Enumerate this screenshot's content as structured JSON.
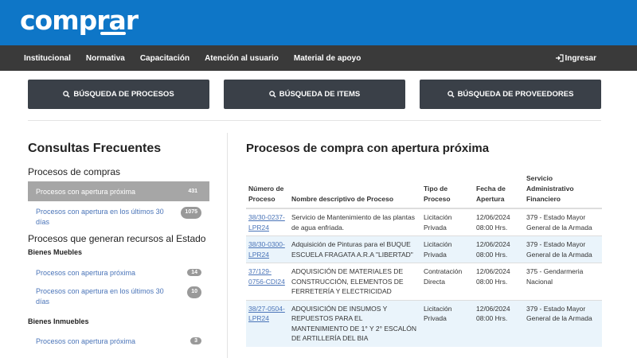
{
  "header": {
    "logo_text": "comprar"
  },
  "nav": {
    "items": [
      "Institucional",
      "Normativa",
      "Capacitación",
      "Atención al usuario",
      "Material de apoyo"
    ],
    "login_label": "Ingresar"
  },
  "search_buttons": [
    {
      "label": "BÚSQUEDA DE PROCESOS"
    },
    {
      "label": "BÚSQUEDA DE ITEMS"
    },
    {
      "label": "BÚSQUEDA DE PROVEEDORES"
    }
  ],
  "sidebar": {
    "title": "Consultas Frecuentes",
    "section1": "Procesos de compras",
    "s1_items": [
      {
        "label": "Procesos con apertura próxima",
        "count": "431"
      },
      {
        "label": "Procesos con apertura en los últimos 30 días",
        "count": "1075"
      }
    ],
    "section2": "Procesos que generan recursos al Estado",
    "sub1": "Bienes Muebles",
    "s2_items": [
      {
        "label": "Procesos con apertura próxima",
        "count": "14"
      },
      {
        "label": "Procesos con apertura en los últimos 30 días",
        "count": "10"
      }
    ],
    "sub2": "Bienes Inmuebles",
    "s3_items": [
      {
        "label": "Procesos con apertura próxima",
        "count": "3"
      }
    ]
  },
  "main": {
    "title": "Procesos de compra con apertura próxima",
    "columns": [
      "Número de Proceso",
      "Nombre descriptivo de Proceso",
      "Tipo de Proceso",
      "Fecha de Apertura",
      "Servicio Administrativo Financiero"
    ],
    "rows": [
      [
        "38/30-0237-LPR24",
        "Servicio de Mantenimiento de las plantas de agua enfriada.",
        "Licitación Privada",
        "12/06/2024 08:00 Hrs.",
        "379 - Estado Mayor General de la Armada"
      ],
      [
        "38/30-0300-LPR24",
        "Adquisición de Pinturas para el BUQUE ESCUELA FRAGATA A.R.A \"LIBERTAD\"",
        "Licitación Privada",
        "12/06/2024 08:00 Hrs.",
        "379 - Estado Mayor General de la Armada"
      ],
      [
        "37/129-0756-CDI24",
        "ADQUISICIÓN DE MATERIALES DE CONSTRUCCIÓN, ELEMENTOS DE FERRETERÍA Y ELECTRICIDAD",
        "Contratación Directa",
        "12/06/2024 08:00 Hrs.",
        "375 - Gendarmeria Nacional"
      ],
      [
        "38/27-0504-LPR24",
        "ADQUISICIÓN DE INSUMOS Y REPUESTOS PARA EL MANTENIMIENTO DE 1° Y 2° ESCALÓN DE ARTILLERÍA DEL BIA",
        "Licitación Privada",
        "12/06/2024 08:00 Hrs.",
        "379 - Estado Mayor General de la Armada"
      ]
    ]
  }
}
